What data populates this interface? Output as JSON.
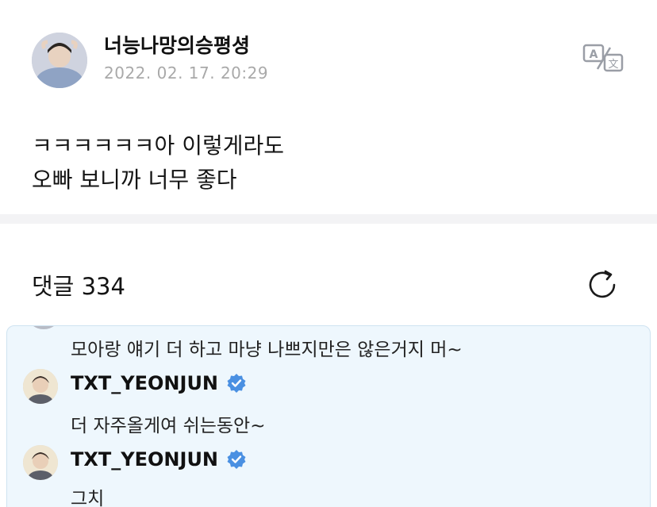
{
  "post": {
    "author": "너능나망의승평셩",
    "date": "2022. 02. 17. 20:29",
    "lines": [
      "ㅋㅋㅋㅋㅋㅋ아 이렇게라도",
      "오빠 보니까 너무 좋다"
    ]
  },
  "comments_header": {
    "label": "댓글",
    "count": "334"
  },
  "comments": [
    {
      "text": "모아랑 얘기 더 하고 마냥 나쁘지만은 않은거지 머~"
    },
    {
      "author": "TXT_YEONJUN",
      "verified": true,
      "text": "더 자주올게여 쉬는동안~"
    },
    {
      "author": "TXT_YEONJUN",
      "verified": true,
      "text": "그치"
    }
  ],
  "icons": {
    "translate": "translate-icon",
    "refresh": "refresh-icon",
    "verified": "verified-badge-icon"
  },
  "colors": {
    "highlight_bg": "#eef7fd",
    "verified_blue": "#4a90e2",
    "date_gray": "#a9a9a9"
  }
}
